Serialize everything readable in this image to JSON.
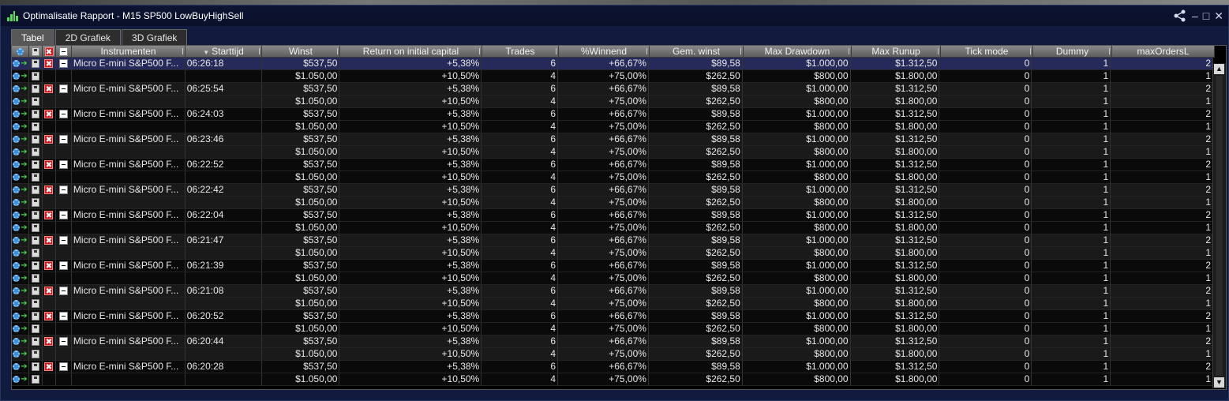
{
  "window": {
    "title": "Optimalisatie Rapport - M15 SP500 LowBuyHighSell"
  },
  "window_buttons": {
    "share": "share-icon",
    "minimize": "–",
    "maximize": "□",
    "close": "✕"
  },
  "tabs": [
    {
      "label": "Tabel",
      "active": true
    },
    {
      "label": "2D Grafiek",
      "active": false
    },
    {
      "label": "3D Grafiek",
      "active": false
    }
  ],
  "columns": {
    "instruments": "Instrumenten",
    "start": "Starttijd",
    "winst": "Winst",
    "return": "Return on initial capital",
    "trades": "Trades",
    "winnend": "%Winnend",
    "gem": "Gem. winst",
    "drawdown": "Max Drawdown",
    "runup": "Max Runup",
    "tick": "Tick mode",
    "dummy": "Dummy",
    "maxorders": "maxOrdersL"
  },
  "sort_indicator": "▼",
  "groups": [
    {
      "instrument": "Micro E-mini S&P500 F...",
      "start": "06:26:18"
    },
    {
      "instrument": "Micro E-mini S&P500 F...",
      "start": "06:25:54"
    },
    {
      "instrument": "Micro E-mini S&P500 F...",
      "start": "06:24:03"
    },
    {
      "instrument": "Micro E-mini S&P500 F...",
      "start": "06:23:46"
    },
    {
      "instrument": "Micro E-mini S&P500 F...",
      "start": "06:22:52"
    },
    {
      "instrument": "Micro E-mini S&P500 F...",
      "start": "06:22:42"
    },
    {
      "instrument": "Micro E-mini S&P500 F...",
      "start": "06:22:04"
    },
    {
      "instrument": "Micro E-mini S&P500 F...",
      "start": "06:21:47"
    },
    {
      "instrument": "Micro E-mini S&P500 F...",
      "start": "06:21:39"
    },
    {
      "instrument": "Micro E-mini S&P500 F...",
      "start": "06:21:08"
    },
    {
      "instrument": "Micro E-mini S&P500 F...",
      "start": "06:20:52"
    },
    {
      "instrument": "Micro E-mini S&P500 F...",
      "start": "06:20:44"
    },
    {
      "instrument": "Micro E-mini S&P500 F...",
      "start": "06:20:28"
    }
  ],
  "result_a": {
    "winst": "$537,50",
    "return": "+5,38%",
    "trades": "6",
    "winnend": "+66,67%",
    "gem": "$89,58",
    "drawdown": "$1.000,00",
    "runup": "$1.312,50",
    "tick": "0",
    "dummy": "1",
    "maxorders": "2"
  },
  "result_b": {
    "winst": "$1.050,00",
    "return": "+10,50%",
    "trades": "4",
    "winnend": "+75,00%",
    "gem": "$262,50",
    "drawdown": "$800,00",
    "runup": "$1.800,00",
    "tick": "0",
    "dummy": "1",
    "maxorders": "1"
  },
  "row_icons": {
    "gear": "gear-icon",
    "arrow": "➔",
    "save": "save-icon",
    "delete": "✖",
    "collapse": "collapse-icon"
  },
  "scrollbar": {
    "up": "▲",
    "down": "▼"
  },
  "colors": {
    "window_bg": "#111b3d",
    "grid_bg": "#000000",
    "selected_row": "#262a5a",
    "header_bg": "#6e6e6e"
  }
}
